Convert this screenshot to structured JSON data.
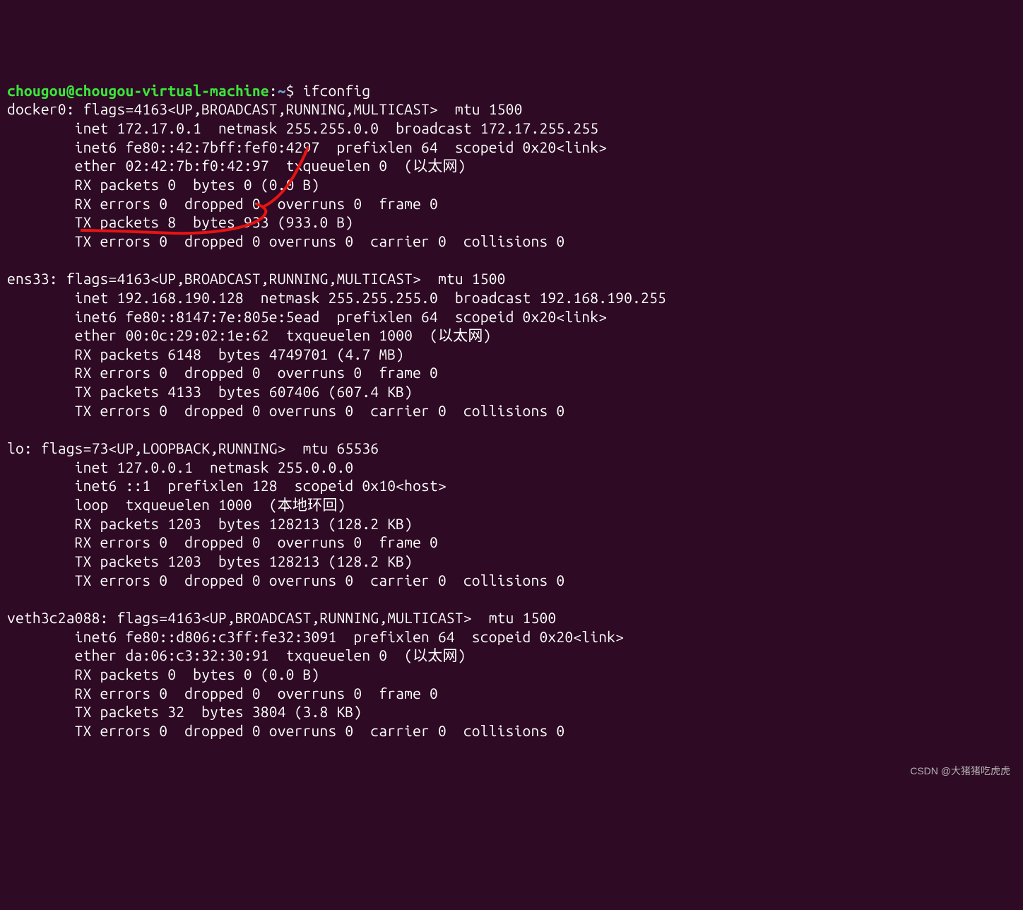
{
  "prompt": {
    "user": "chougou",
    "at": "@",
    "host": "chougou-virtual-machine",
    "colon": ":",
    "path": "~",
    "dollar": "$",
    "command": " ifconfig"
  },
  "interfaces": {
    "docker0": {
      "header": "docker0: flags=4163<UP,BROADCAST,RUNNING,MULTICAST>  mtu 1500",
      "l1": "        inet 172.17.0.1  netmask 255.255.0.0  broadcast 172.17.255.255",
      "l2": "        inet6 fe80::42:7bff:fef0:4297  prefixlen 64  scopeid 0x20<link>",
      "l3": "        ether 02:42:7b:f0:42:97  txqueuelen 0  (以太网)",
      "l4": "        RX packets 0  bytes 0 (0.0 B)",
      "l5": "        RX errors 0  dropped 0  overruns 0  frame 0",
      "l6": "        TX packets 8  bytes 933 (933.0 B)",
      "l7": "        TX errors 0  dropped 0 overruns 0  carrier 0  collisions 0"
    },
    "ens33": {
      "header": "ens33: flags=4163<UP,BROADCAST,RUNNING,MULTICAST>  mtu 1500",
      "l1": "        inet 192.168.190.128  netmask 255.255.255.0  broadcast 192.168.190.255",
      "l2": "        inet6 fe80::8147:7e:805e:5ead  prefixlen 64  scopeid 0x20<link>",
      "l3": "        ether 00:0c:29:02:1e:62  txqueuelen 1000  (以太网)",
      "l4": "        RX packets 6148  bytes 4749701 (4.7 MB)",
      "l5": "        RX errors 0  dropped 0  overruns 0  frame 0",
      "l6": "        TX packets 4133  bytes 607406 (607.4 KB)",
      "l7": "        TX errors 0  dropped 0 overruns 0  carrier 0  collisions 0"
    },
    "lo": {
      "header": "lo: flags=73<UP,LOOPBACK,RUNNING>  mtu 65536",
      "l1": "        inet 127.0.0.1  netmask 255.0.0.0",
      "l2": "        inet6 ::1  prefixlen 128  scopeid 0x10<host>",
      "l3": "        loop  txqueuelen 1000  (本地环回)",
      "l4": "        RX packets 1203  bytes 128213 (128.2 KB)",
      "l5": "        RX errors 0  dropped 0  overruns 0  frame 0",
      "l6": "        TX packets 1203  bytes 128213 (128.2 KB)",
      "l7": "        TX errors 0  dropped 0 overruns 0  carrier 0  collisions 0"
    },
    "veth": {
      "header": "veth3c2a088: flags=4163<UP,BROADCAST,RUNNING,MULTICAST>  mtu 1500",
      "l1": "        inet6 fe80::d806:c3ff:fe32:3091  prefixlen 64  scopeid 0x20<link>",
      "l2": "        ether da:06:c3:32:30:91  txqueuelen 0  (以太网)",
      "l3": "        RX packets 0  bytes 0 (0.0 B)",
      "l4": "        RX errors 0  dropped 0  overruns 0  frame 0",
      "l5": "        TX packets 32  bytes 3804 (3.8 KB)",
      "l6": "        TX errors 0  dropped 0 overruns 0  carrier 0  collisions 0"
    }
  },
  "watermark": "CSDN @大猪猪吃虎虎"
}
